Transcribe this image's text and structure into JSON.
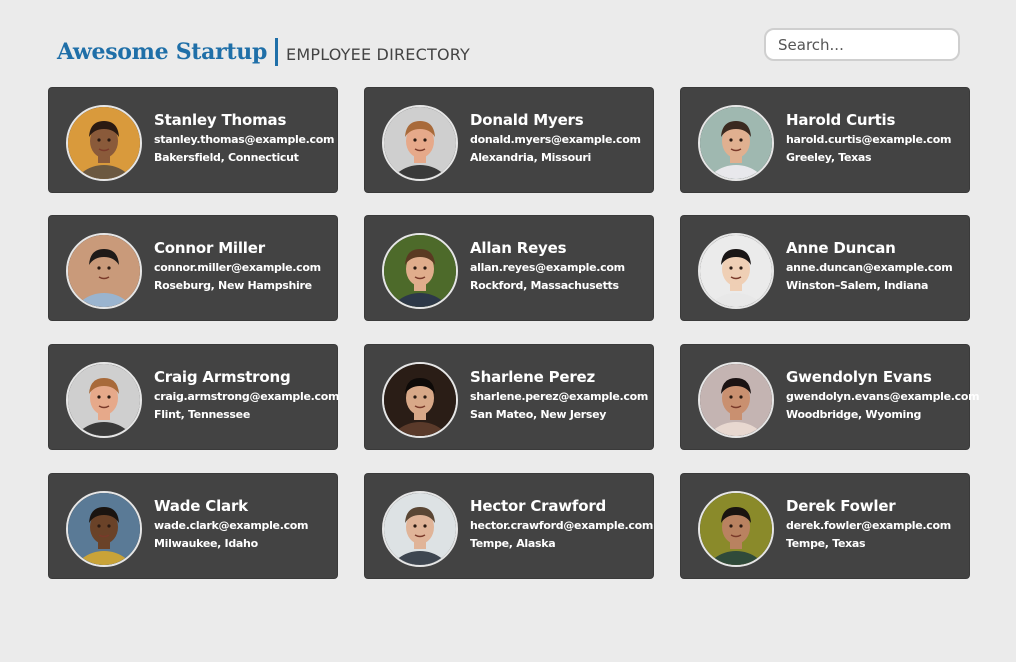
{
  "header": {
    "brand": "Awesome Startup",
    "subtitle": "EMPLOYEE DIRECTORY"
  },
  "search": {
    "placeholder": "Search..."
  },
  "employees": [
    {
      "name": "Stanley Thomas",
      "email": "stanley.thomas@example.com",
      "location": "Bakersfield, Connecticut",
      "bg": "#d99a3c",
      "skin": "#8a5a3a",
      "hair": "#2a1a12",
      "shirt": "#6b5840"
    },
    {
      "name": "Donald Myers",
      "email": "donald.myers@example.com",
      "location": "Alexandria, Missouri",
      "bg": "#cfcfcf",
      "skin": "#e6a98a",
      "hair": "#a86a3a",
      "shirt": "#3a3a3a"
    },
    {
      "name": "Harold Curtis",
      "email": "harold.curtis@example.com",
      "location": "Greeley, Texas",
      "bg": "#9fb8b0",
      "skin": "#e0b090",
      "hair": "#3a2a20",
      "shirt": "#e8e8ec"
    },
    {
      "name": "Connor Miller",
      "email": "connor.miller@example.com",
      "location": "Roseburg, New Hampshire",
      "bg": "#c99a7a",
      "skin": "#c99a7a",
      "hair": "#1e1a18",
      "shirt": "#9ab4cf"
    },
    {
      "name": "Allan Reyes",
      "email": "allan.reyes@example.com",
      "location": "Rockford, Massachusetts",
      "bg": "#4d6a2a",
      "skin": "#e0ad8c",
      "hair": "#5a3a22",
      "shirt": "#2d3848"
    },
    {
      "name": "Anne Duncan",
      "email": "anne.duncan@example.com",
      "location": "Winston–Salem, Indiana",
      "bg": "#ebebeb",
      "skin": "#efcfb5",
      "hair": "#1a1616",
      "shirt": "#e8e8e8"
    },
    {
      "name": "Craig Armstrong",
      "email": "craig.armstrong@example.com",
      "location": "Flint, Tennessee",
      "bg": "#cfcfcf",
      "skin": "#e6a98a",
      "hair": "#a86a3a",
      "shirt": "#3a3a3a"
    },
    {
      "name": "Sharlene Perez",
      "email": "sharlene.perez@example.com",
      "location": "San Mateo, New Jersey",
      "bg": "#2a1d16",
      "skin": "#d8a888",
      "hair": "#0e0a08",
      "shirt": "#5a3a2a"
    },
    {
      "name": "Gwendolyn Evans",
      "email": "gwendolyn.evans@example.com",
      "location": "Woodbridge, Wyoming",
      "bg": "#c4b4b2",
      "skin": "#c99070",
      "hair": "#1a1212",
      "shirt": "#e8d8d0"
    },
    {
      "name": "Wade Clark",
      "email": "wade.clark@example.com",
      "location": "Milwaukee, Idaho",
      "bg": "#5a7a96",
      "skin": "#6a4228",
      "hair": "#1a1410",
      "shirt": "#c9a338"
    },
    {
      "name": "Hector Crawford",
      "email": "hector.crawford@example.com",
      "location": "Tempe, Alaska",
      "bg": "#dde2e4",
      "skin": "#e0b498",
      "hair": "#5a4634",
      "shirt": "#3e4650"
    },
    {
      "name": "Derek Fowler",
      "email": "derek.fowler@example.com",
      "location": "Tempe, Texas",
      "bg": "#8a8a2a",
      "skin": "#b98260",
      "hair": "#1a1410",
      "shirt": "#2f4a3a"
    }
  ]
}
